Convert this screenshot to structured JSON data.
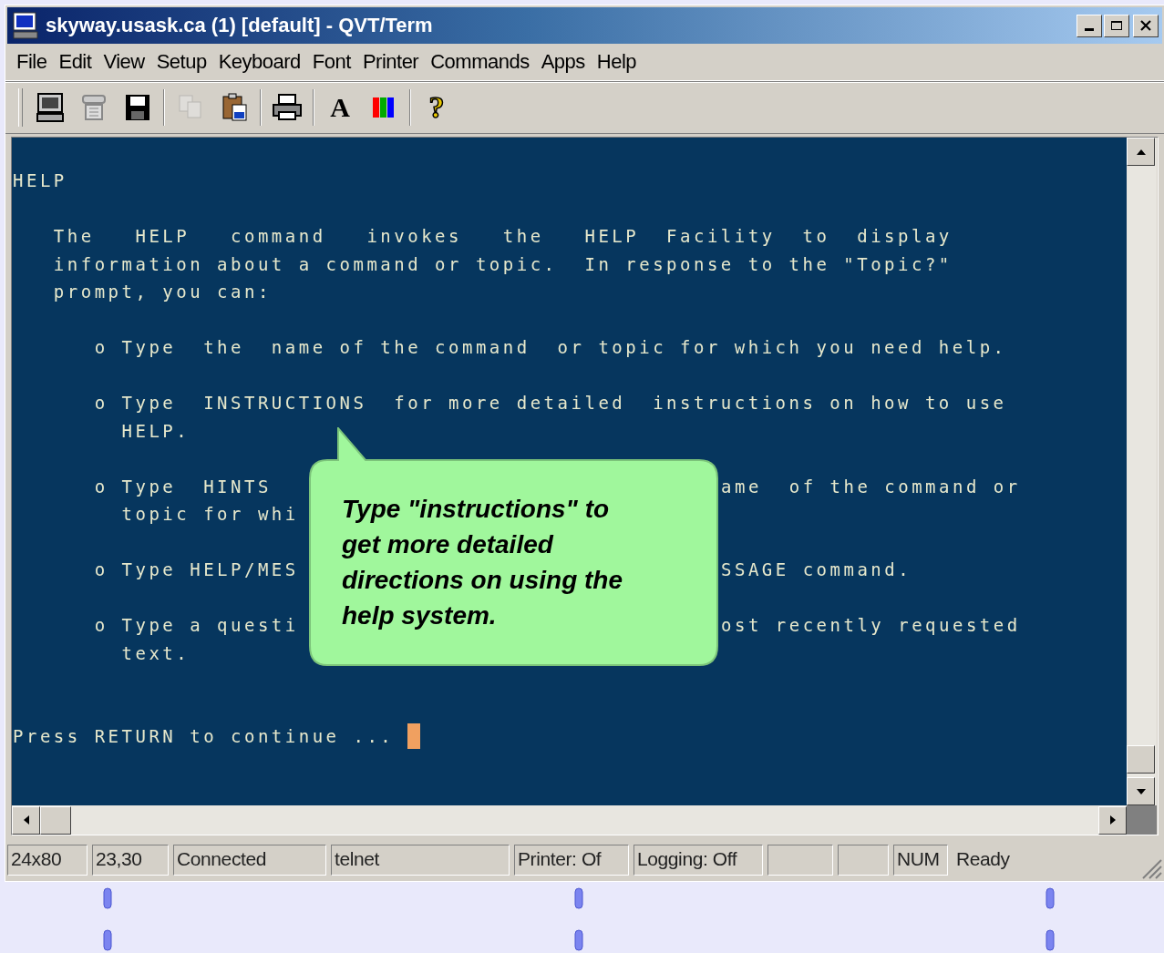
{
  "window": {
    "title": "skyway.usask.ca (1) [default] - QVT/Term"
  },
  "menu": [
    "File",
    "Edit",
    "View",
    "Setup",
    "Keyboard",
    "Font",
    "Printer",
    "Commands",
    "Apps",
    "Help"
  ],
  "toolbar": [
    {
      "kind": "terminal",
      "disabled": false
    },
    {
      "kind": "disconnect",
      "disabled": false
    },
    {
      "kind": "save",
      "disabled": false
    },
    {
      "kind": "separator"
    },
    {
      "kind": "copy",
      "disabled": true
    },
    {
      "kind": "paste",
      "disabled": false
    },
    {
      "kind": "separator"
    },
    {
      "kind": "print",
      "disabled": false
    },
    {
      "kind": "separator"
    },
    {
      "kind": "font",
      "label": "A",
      "disabled": false
    },
    {
      "kind": "colors",
      "disabled": false
    },
    {
      "kind": "separator"
    },
    {
      "kind": "help",
      "label": "?",
      "disabled": false
    }
  ],
  "terminal": {
    "paragraphs": [
      [
        {
          "text": "HELP"
        }
      ],
      [
        {
          "text": "   The   HELP   command   invokes   the   HELP  Facility  to  display"
        },
        {
          "text": "   information about a command or topic.  In response to the \"Topic?\""
        },
        {
          "text": "   prompt, you can:"
        }
      ],
      [
        {
          "text": "      o Type  the  name of the command  or topic for which you need help."
        }
      ],
      [
        {
          "text": "      o Type  INSTRUCTIONS  for more detailed  instructions on how to use"
        },
        {
          "text": "        HELP."
        }
      ],
      [
        {
          "text": "      o Type  HINTS",
          "text_after_callout": "ame  of the command or"
        },
        {
          "text": "        topic for whi"
        }
      ],
      [
        {
          "text": "      o Type HELP/MES",
          "text_after_callout": "SSAGE command."
        }
      ],
      [
        {
          "text": "      o Type a questi",
          "text_after_callout": "ost recently requested"
        },
        {
          "text": "        text."
        }
      ]
    ],
    "prompt": "Press RETURN to continue ... ",
    "callout": "Type \"instructions\" to get more detailed directions on using the help system."
  },
  "status_bar": [
    {
      "kind": "text",
      "text": "24x80"
    },
    {
      "kind": "text",
      "text": "23,30"
    },
    {
      "kind": "text",
      "text": "Connected"
    },
    {
      "kind": "text",
      "text": "telnet"
    },
    {
      "kind": "text",
      "text": "Printer: Of"
    },
    {
      "kind": "text",
      "text": "Logging: Off"
    },
    {
      "kind": "empty"
    },
    {
      "kind": "empty"
    },
    {
      "kind": "text",
      "text": "NUM"
    },
    {
      "kind": "plain",
      "text": "Ready"
    }
  ]
}
